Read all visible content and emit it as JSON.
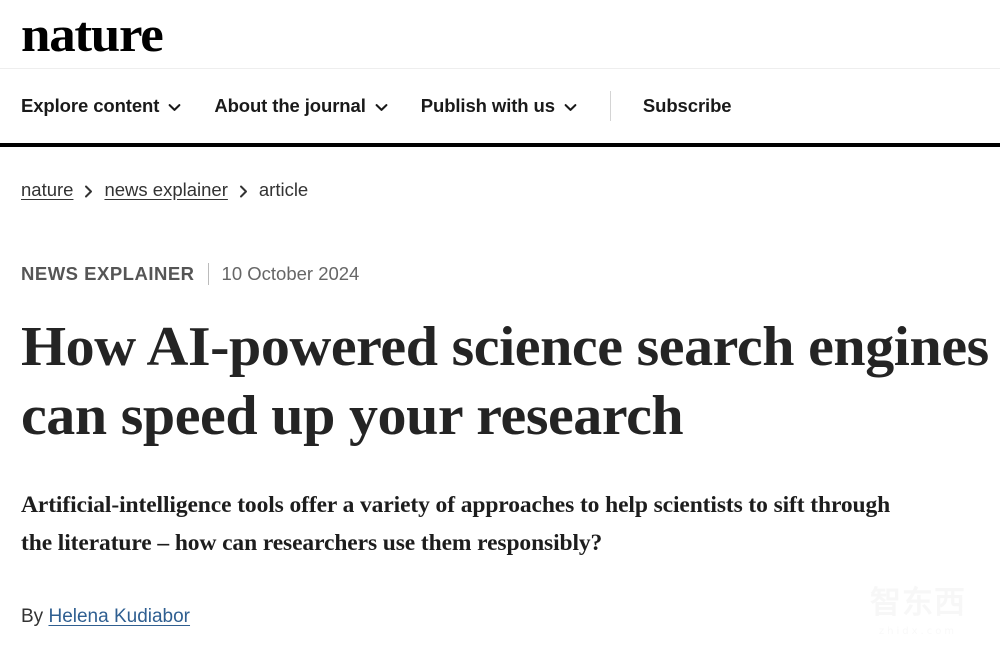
{
  "masthead": {
    "logo_text": "nature"
  },
  "nav": {
    "items": [
      {
        "label": "Explore content",
        "icon": "chevron-down-icon",
        "has_chevron": true
      },
      {
        "label": "About the journal",
        "icon": "chevron-down-icon",
        "has_chevron": true
      },
      {
        "label": "Publish with us",
        "icon": "chevron-down-icon",
        "has_chevron": true
      },
      {
        "label": "Subscribe",
        "has_chevron": false
      }
    ]
  },
  "breadcrumb": {
    "items": [
      {
        "label": "nature",
        "is_link": true
      },
      {
        "label": "news explainer",
        "is_link": true
      },
      {
        "label": "article",
        "is_link": false
      }
    ],
    "separator_icon": "chevron-right-icon"
  },
  "article": {
    "type": "NEWS EXPLAINER",
    "date": "10 October 2024",
    "headline": "How AI-powered science search engines can speed up your research",
    "standfirst": "Artificial-intelligence tools offer a variety of approaches to help scientists to sift through the literature – how can researchers use them responsibly?",
    "byline_prefix": "By",
    "author": "Helena Kudiabor"
  },
  "watermark": {
    "glyphs": "智东西",
    "domain": "zhidx.com"
  },
  "colors": {
    "link_blue": "#2f5f91",
    "headline": "#242424",
    "rule_black": "#000000",
    "meta_gray": "#555555"
  }
}
